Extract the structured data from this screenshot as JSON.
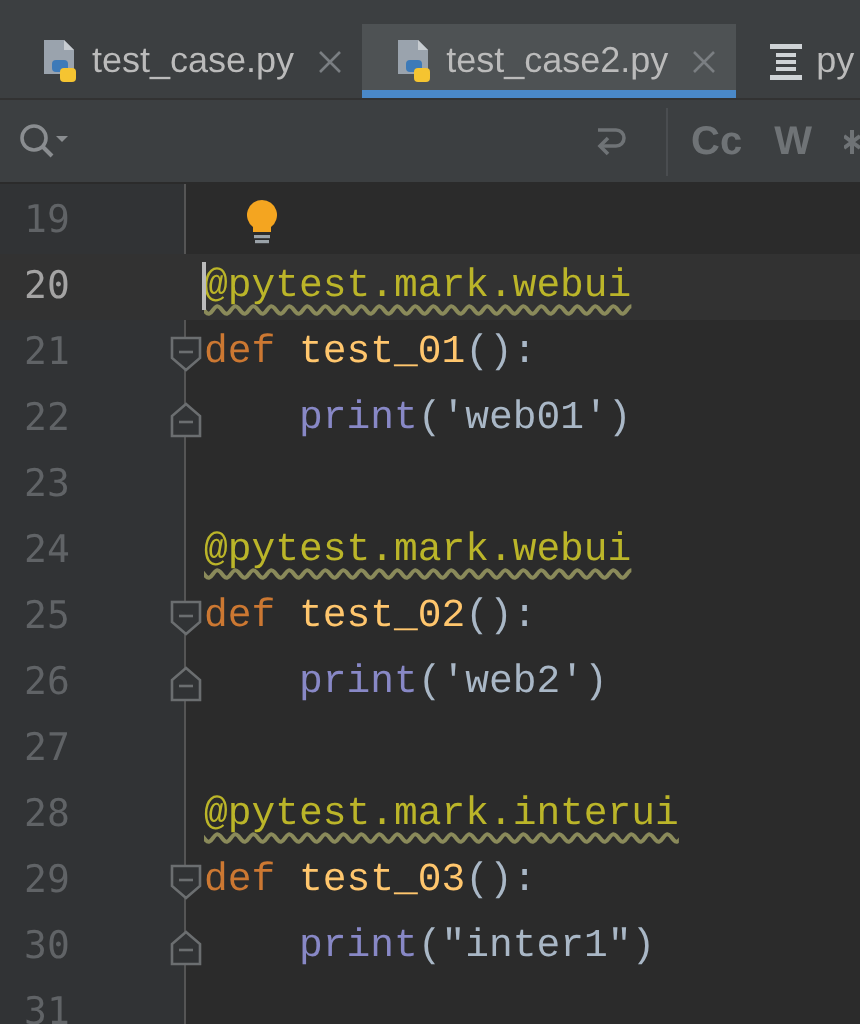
{
  "tabs": [
    {
      "label": "test_case.py",
      "kind": "python",
      "selected": false,
      "closable": true
    },
    {
      "label": "test_case2.py",
      "kind": "python",
      "selected": true,
      "closable": true
    },
    {
      "label": "py",
      "kind": "stack",
      "selected": false,
      "closable": false
    }
  ],
  "search_bar": {
    "buttons": [
      "Cc",
      "W"
    ]
  },
  "editor": {
    "lines": [
      {
        "number": "19",
        "kind": "blank",
        "current": false,
        "hint": true
      },
      {
        "number": "20",
        "kind": "top",
        "current": true,
        "caret": true,
        "tokens": [
          {
            "kind": "decorator",
            "text": "@pytest.mark.webui"
          }
        ]
      },
      {
        "number": "21",
        "kind": "top",
        "current": false,
        "fold_marker": {
          "kind": "start"
        },
        "tokens": [
          {
            "kind": "keyword",
            "text": "def "
          },
          {
            "kind": "function",
            "text": "test_01"
          },
          {
            "kind": "plain",
            "text": "():"
          }
        ]
      },
      {
        "number": "22",
        "kind": "body",
        "current": false,
        "fold_marker": {
          "kind": "end"
        },
        "tokens": [
          {
            "kind": "builtin",
            "text": "print"
          },
          {
            "kind": "plain",
            "text": "('web01')"
          }
        ]
      },
      {
        "number": "23",
        "kind": "blank",
        "current": false
      },
      {
        "number": "24",
        "kind": "top",
        "current": false,
        "tokens": [
          {
            "kind": "decorator",
            "text": "@pytest.mark.webui"
          }
        ]
      },
      {
        "number": "25",
        "kind": "top",
        "current": false,
        "fold_marker": {
          "kind": "start"
        },
        "tokens": [
          {
            "kind": "keyword",
            "text": "def "
          },
          {
            "kind": "function",
            "text": "test_02"
          },
          {
            "kind": "plain",
            "text": "():"
          }
        ]
      },
      {
        "number": "26",
        "kind": "body",
        "current": false,
        "fold_marker": {
          "kind": "end"
        },
        "tokens": [
          {
            "kind": "builtin",
            "text": "print"
          },
          {
            "kind": "plain",
            "text": "('web2')"
          }
        ]
      },
      {
        "number": "27",
        "kind": "blank",
        "current": false
      },
      {
        "number": "28",
        "kind": "top",
        "current": false,
        "tokens": [
          {
            "kind": "decorator",
            "text": "@pytest.mark.interui"
          }
        ]
      },
      {
        "number": "29",
        "kind": "top",
        "current": false,
        "fold_marker": {
          "kind": "start"
        },
        "tokens": [
          {
            "kind": "keyword",
            "text": "def "
          },
          {
            "kind": "function",
            "text": "test_03"
          },
          {
            "kind": "plain",
            "text": "():"
          }
        ]
      },
      {
        "number": "30",
        "kind": "body",
        "current": false,
        "fold_marker": {
          "kind": "end"
        },
        "tokens": [
          {
            "kind": "builtin",
            "text": "print"
          },
          {
            "kind": "plain",
            "text": "(\"inter1\")"
          }
        ]
      },
      {
        "number": "31",
        "kind": "blank",
        "current": false
      }
    ]
  }
}
